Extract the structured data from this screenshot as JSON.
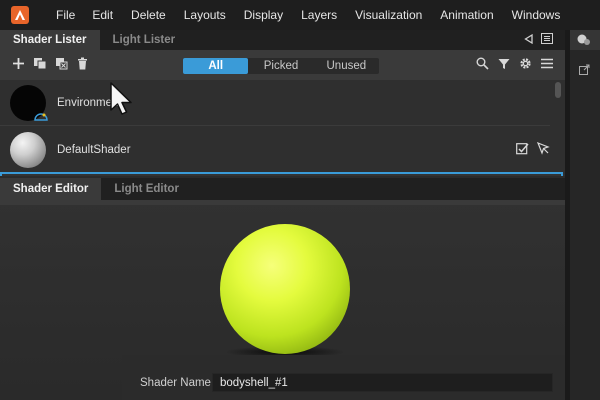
{
  "menu": {
    "items": [
      "File",
      "Edit",
      "Delete",
      "Layouts",
      "Display",
      "Layers",
      "Visualization",
      "Animation",
      "Windows"
    ]
  },
  "top_tabs": {
    "shader_lister": "Shader Lister",
    "light_lister": "Light Lister"
  },
  "filters": {
    "all": "All",
    "picked": "Picked",
    "unused": "Unused",
    "selected": "All"
  },
  "shaders": [
    {
      "name": "Environment",
      "thumb": "black-sphere"
    },
    {
      "name": "DefaultShader",
      "thumb": "grey-sphere"
    }
  ],
  "bottom_tabs": {
    "shader_editor": "Shader Editor",
    "light_editor": "Light Editor"
  },
  "editor": {
    "preview_color": "#d8f53a",
    "shader_name_label": "Shader Name",
    "shader_name_value": "bodyshell_#1"
  },
  "colors": {
    "accent": "#3a9bd8",
    "brand": "#e8652a"
  }
}
